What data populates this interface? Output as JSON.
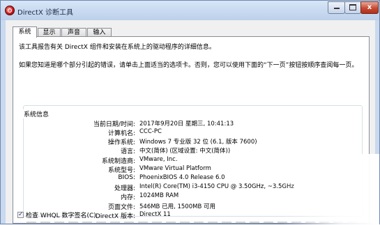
{
  "window": {
    "title": "DirectX 诊断工具"
  },
  "caption_buttons": {
    "close": "x"
  },
  "tabs": [
    {
      "label": "系统",
      "active": true
    },
    {
      "label": "显示",
      "active": false
    },
    {
      "label": "声音",
      "active": false
    },
    {
      "label": "输入",
      "active": false
    }
  ],
  "intro": {
    "line1": "该工具报告有关 DirectX 组件和安装在系统上的驱动程序的详细信息。",
    "line2": "如果您知道是哪个部分引起的错误，请单击上面适当的选项卡。否则，您可以使用下面的“下一页”按钮按顺序查阅每一页。"
  },
  "system_info": {
    "title": "系统信息",
    "rows": [
      {
        "key": "当前日期/时间:",
        "value": "2017年9月20日 星期三, 10:41:13"
      },
      {
        "key": "计算机名:",
        "value": "CCC-PC"
      },
      {
        "key": "操作系统:",
        "value": "Windows 7 专业版 32 位 (6.1, 版本 7600)"
      },
      {
        "key": "语言:",
        "value": "中文(简体) (区域设置: 中文(简体))"
      },
      {
        "key": "系统制造商:",
        "value": "VMware, Inc."
      },
      {
        "key": "系统型号:",
        "value": "VMware Virtual Platform"
      },
      {
        "key": "BIOS:",
        "value": "PhoenixBIOS 4.0 Release 6.0"
      },
      {
        "key": "处理器:",
        "value": "Intel(R) Core(TM) i3-4150 CPU @ 3.50GHz, ~3.5GHz"
      },
      {
        "key": "内存:",
        "value": "1024MB RAM"
      },
      {
        "key": "页面文件:",
        "value": "546MB 已用, 1500MB 可用"
      },
      {
        "key": "DirectX 版本:",
        "value": "DirectX 11"
      }
    ]
  },
  "whql_check": {
    "label": "检查 WHQL 数字签名(C)",
    "checked": true,
    "mark": "✓"
  }
}
